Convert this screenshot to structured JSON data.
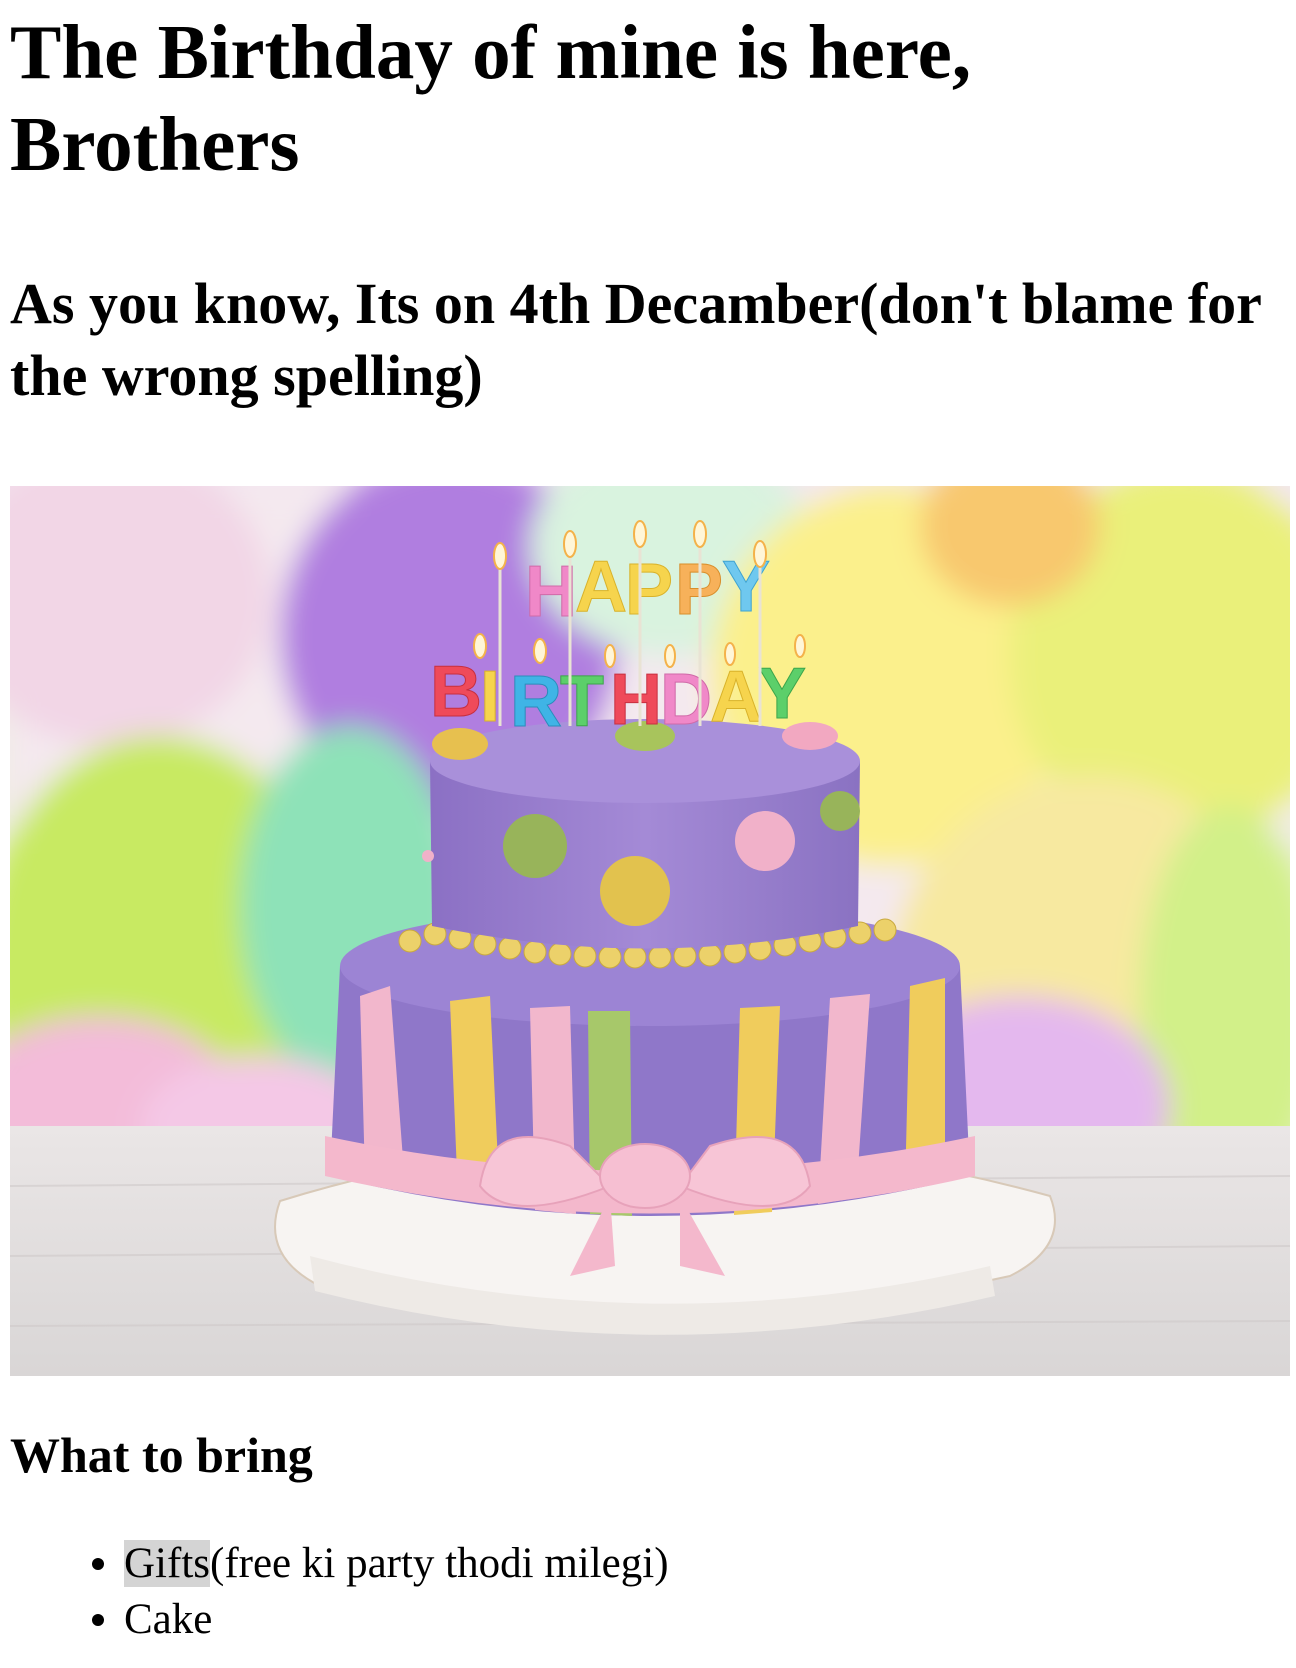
{
  "heading": "The Birthday of mine is here, Brothers",
  "subheading": "As you know, Its on 4th Decamber(don't blame for the wrong spelling)",
  "image": {
    "candle_letters_top": [
      "H",
      "A",
      "P",
      "P",
      "Y"
    ],
    "candle_letters_bottom": [
      "B",
      "I",
      "R",
      "T",
      "H",
      "D",
      "A",
      "Y"
    ]
  },
  "section_title": "What to bring",
  "bring_list": [
    {
      "highlight": "Gifts",
      "rest": "(free ki party thodi milegi)"
    },
    {
      "highlight": "",
      "rest": "Cake"
    }
  ],
  "colors": {
    "text": "#000000",
    "highlight": "#d4d4d4",
    "cake_purple": "#9a82d0",
    "cake_pink": "#f2b7cc",
    "cake_yellow": "#f0cc5c",
    "cake_green": "#a7c86a"
  }
}
